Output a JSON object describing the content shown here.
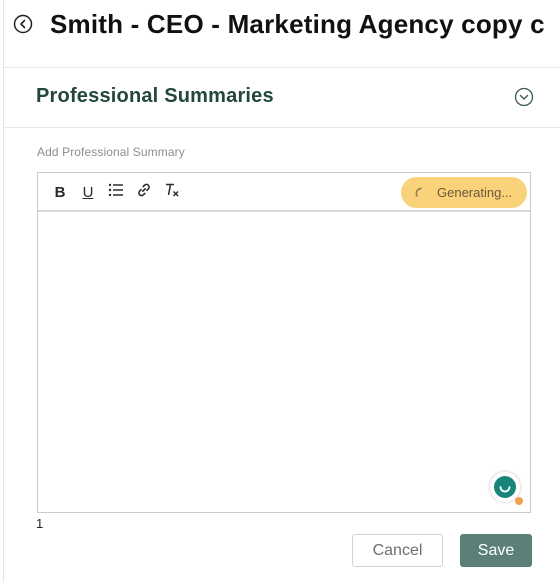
{
  "header": {
    "back_icon": "arrow-left-circle-icon",
    "title": "Smith - CEO - Marketing Agency copy c"
  },
  "section": {
    "title": "Professional Summaries",
    "toggle_icon": "chevron-down-circle-icon"
  },
  "field": {
    "label": "Add Professional Summary"
  },
  "toolbar": {
    "bold": "B",
    "underline": "U",
    "list_icon": "bulleted-list-icon",
    "link_icon": "link-icon",
    "clear_format_icon": "clear-formatting-icon",
    "generating_label": "Generating..."
  },
  "editor": {
    "value": "",
    "char_count": "1",
    "assistant_icon": "writing-assistant-icon"
  },
  "actions": {
    "cancel_label": "Cancel",
    "save_label": "Save"
  },
  "colors": {
    "section_title": "#24463f",
    "generating_bg": "#f9d27a",
    "save_bg": "#5b8077",
    "assistant": "#17857a"
  }
}
